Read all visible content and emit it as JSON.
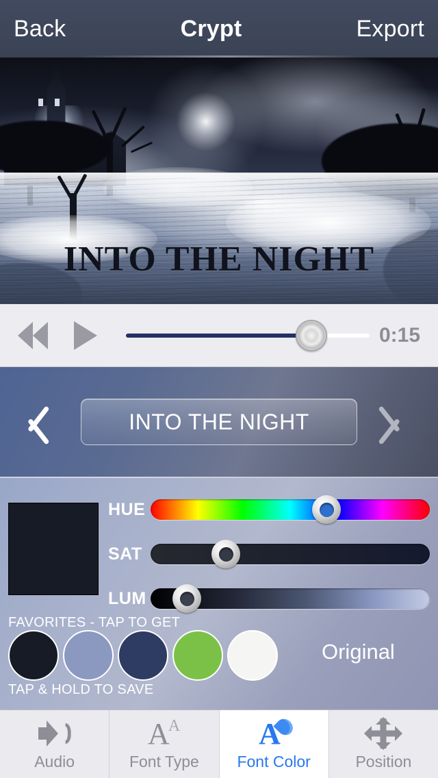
{
  "navbar": {
    "back_label": "Back",
    "title": "Crypt",
    "export_label": "Export"
  },
  "preview": {
    "overlay_text": "INTO THE NIGHT",
    "scene_description": "Haunted Victorian mansion at night with bare trees over a lake"
  },
  "player": {
    "rewind_icon": "rewind-icon",
    "play_icon": "play-icon",
    "time_label": "0:15",
    "progress_percent": 76,
    "fill_color": "#252f62",
    "track_color": "#ffffff"
  },
  "selector": {
    "prev_icon": "chevron-left-icon",
    "next_icon": "chevron-right-icon",
    "current_text": "INTO THE NIGHT"
  },
  "color_panel": {
    "preview_color": "#171b26",
    "sliders": [
      {
        "label": "HUE",
        "value_percent": 63,
        "knob_color": "#2f6fd0"
      },
      {
        "label": "SAT",
        "value_percent": 27,
        "knob_color": "#343a46"
      },
      {
        "label": "LUM",
        "value_percent": 13,
        "knob_color": "#3b414f"
      }
    ],
    "favorites_top_label": "FAVORITES - TAP TO GET",
    "favorites_bottom_label": "TAP & HOLD TO SAVE",
    "favorites": [
      {
        "name": "near-black",
        "color": "#161b26"
      },
      {
        "name": "periwinkle",
        "color": "#8b99c0"
      },
      {
        "name": "navy",
        "color": "#2e3b63"
      },
      {
        "name": "green",
        "color": "#7cc147"
      },
      {
        "name": "white",
        "color": "#f5f5f3"
      }
    ],
    "original_label": "Original"
  },
  "tabbar": {
    "active_color": "#2878f0",
    "inactive_color": "#8e8e96",
    "tabs": [
      {
        "label": "Audio",
        "icon": "speaker-icon",
        "active": false
      },
      {
        "label": "Font Type",
        "icon": "font-type-icon",
        "active": false
      },
      {
        "label": "Font Color",
        "icon": "font-color-droplet-icon",
        "active": true
      },
      {
        "label": "Position",
        "icon": "move-arrows-icon",
        "active": false
      }
    ]
  }
}
